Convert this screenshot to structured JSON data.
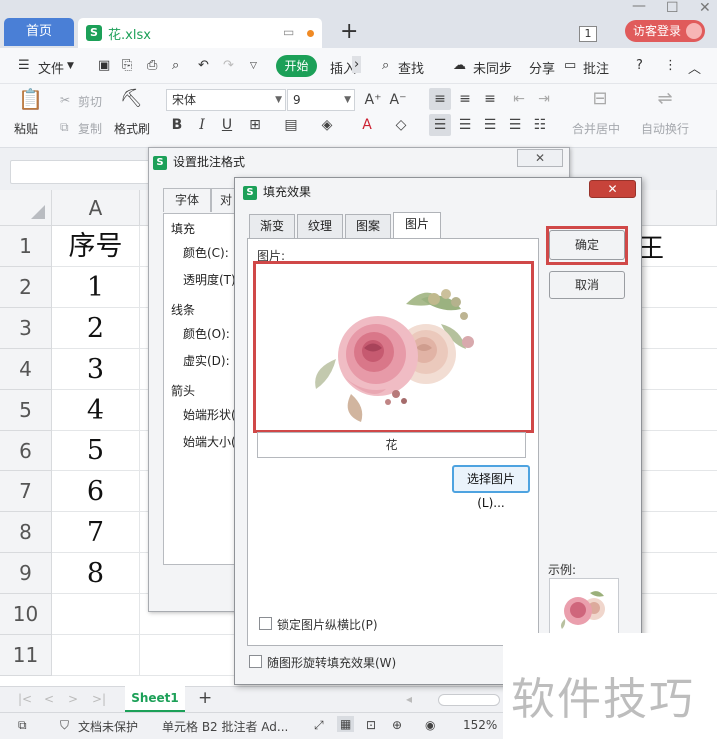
{
  "tabs": {
    "home": "首页",
    "file": "花.xlsx",
    "new_tab": "+"
  },
  "title_bar": {
    "window_number": "1",
    "visitor_login": "访客登录"
  },
  "menu": {
    "file": "文件",
    "start": "开始",
    "insert": "插入",
    "find": "查找",
    "sync": "未同步",
    "share": "分享",
    "annotate": "批注",
    "help": "?"
  },
  "ribbon": {
    "paste": "粘贴",
    "cut": "剪切",
    "copy": "复制",
    "format_painter": "格式刷",
    "font_name": "宋体",
    "font_size": "9",
    "merge_center": "合并居中",
    "auto_wrap": "自动换行"
  },
  "sheet": {
    "col_a": "A",
    "rows": [
      "1",
      "2",
      "3",
      "4",
      "5",
      "6",
      "7",
      "8",
      "9",
      "10",
      "11"
    ],
    "col_a_values": [
      "序号",
      "1",
      "2",
      "3",
      "4",
      "5",
      "6",
      "7",
      "8",
      "",
      ""
    ],
    "partial_e1": "王"
  },
  "sheet_tab": "Sheet1",
  "status": {
    "protect": "文档未保护",
    "cell_info": "单元格 B2 批注者 Ad...",
    "zoom": "152%"
  },
  "dialog_comment": {
    "title": "设置批注格式",
    "close": "✕",
    "tabs": [
      "字体",
      "对"
    ],
    "fill_section": "填充",
    "color": "颜色(C):",
    "transparency": "透明度(T)",
    "line_section": "线条",
    "line_color": "颜色(O):",
    "dash": "虚实(D):",
    "arrow_section": "箭头",
    "start_shape": "始端形状(",
    "start_size": "始端大小("
  },
  "dialog_fill": {
    "title": "填充效果",
    "close": "✕",
    "tabs": [
      "渐变",
      "纹理",
      "图案",
      "图片"
    ],
    "active_tab": "图片",
    "picture_label": "图片:",
    "picture_name": "花",
    "select_picture": "选择图片(L)...",
    "lock_ratio": "锁定图片纵横比(P)",
    "rotate_with_shape": "随图形旋转填充效果(W)",
    "ok": "确定",
    "cancel": "取消",
    "sample": "示例:"
  },
  "watermark": "软件技巧",
  "colors": {
    "accent_green": "#1ca058",
    "home_tab_blue": "#4a7fd6",
    "highlight_red": "#d04848",
    "close_red": "#c7433a"
  }
}
